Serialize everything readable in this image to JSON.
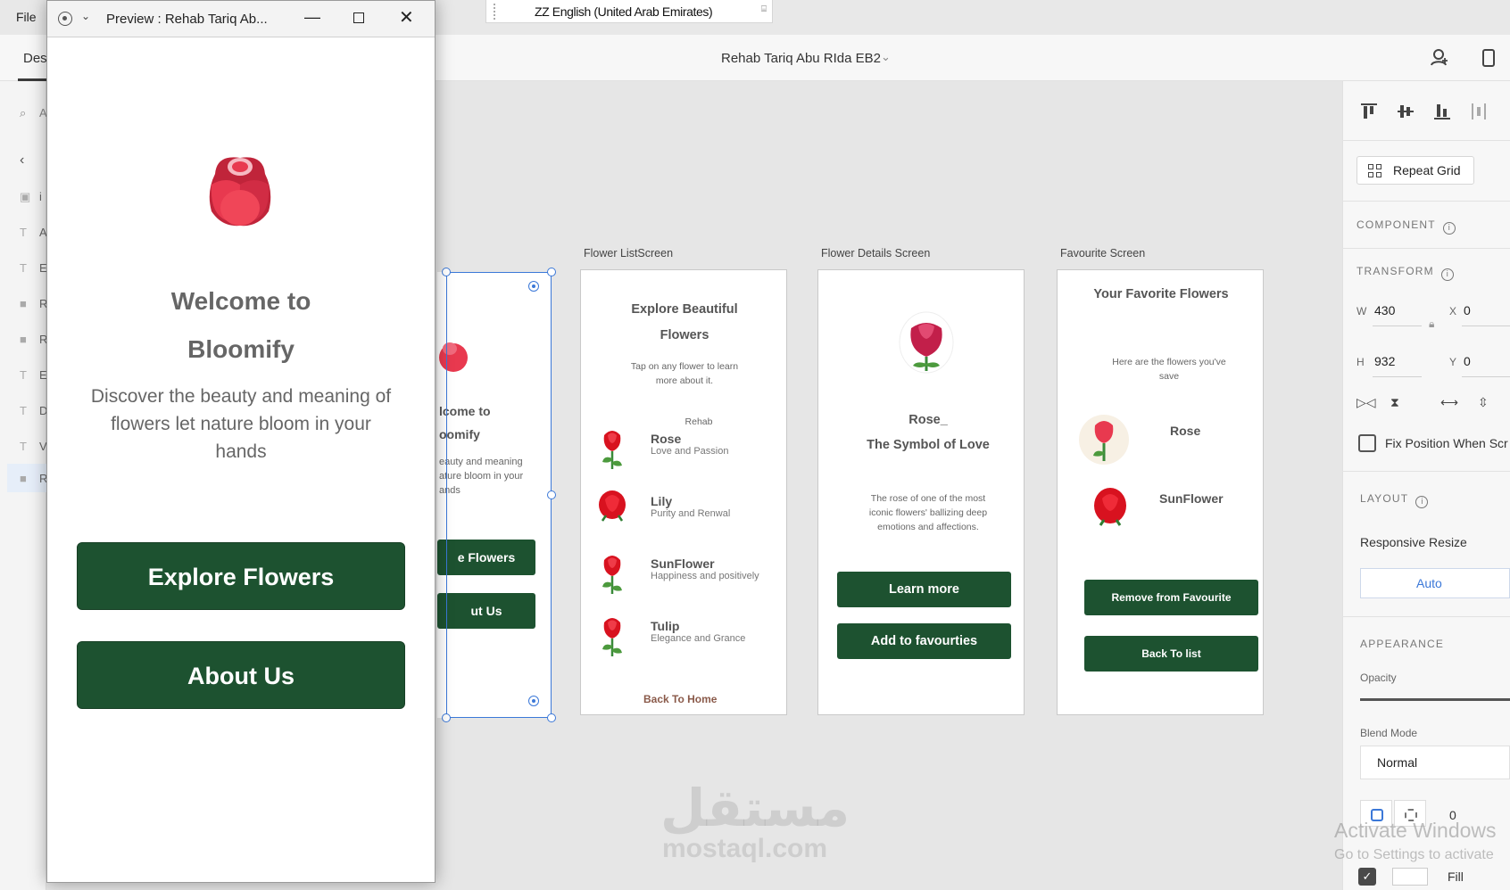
{
  "menu": {
    "file": "File"
  },
  "ime": {
    "label": "ZZ English (United Arab Emirates)"
  },
  "toolbar": {
    "tab_design": "Des",
    "document_title": "Rehab Tariq Abu RIda EB2"
  },
  "left_panel": {
    "search_glyph": "A",
    "items": [
      "i",
      "A",
      "E",
      "R",
      "R",
      "E",
      "D",
      "V",
      "R"
    ]
  },
  "preview": {
    "window_title": "Preview : Rehab Tariq Ab...",
    "heading_line1": "Welcome to",
    "heading_line2": "Bloomify",
    "description": "Discover the beauty and meaning of flowers let nature bloom in your hands",
    "explore_button": "Explore Flowers",
    "about_button": "About Us"
  },
  "artboards": {
    "partial": {
      "heading1": "lcome to",
      "heading2": "oomify",
      "desc": "eauty and meaning\nature bloom in your\nands",
      "btn1": "e Flowers",
      "btn2": "ut Us"
    },
    "list": {
      "label": "Flower ListScreen",
      "title": "Explore Beautiful Flowers",
      "subtitle": "Tap on any flower to learn more about it.",
      "author": "Rehab",
      "items": [
        {
          "name": "Rose",
          "desc": "Love and Passion"
        },
        {
          "name": "Lily",
          "desc": "Purity and Renwal"
        },
        {
          "name": "SunFlower",
          "desc": "Happiness and positively"
        },
        {
          "name": "Tulip",
          "desc": "Elegance and Grance"
        }
      ],
      "back_link": "Back To Home"
    },
    "details": {
      "label": "Flower Details Screen",
      "name": "Rose_",
      "tagline": "The Symbol of Love",
      "description": "The rose of one of the most iconic flowers' ballizing deep emotions and affections.",
      "learn_more": "Learn more",
      "add_fav": "Add to favourties"
    },
    "favourite": {
      "label": "Favourite Screen",
      "title": "Your Favorite Flowers",
      "subtitle": "Here are the flowers you've save",
      "items": [
        {
          "name": "Rose"
        },
        {
          "name": "SunFlower"
        }
      ],
      "remove_btn": "Remove from Favourite",
      "back_btn": "Back To list"
    }
  },
  "right_panel": {
    "repeat_grid": "Repeat Grid",
    "component_label": "COMPONENT",
    "transform_label": "TRANSFORM",
    "w_label": "W",
    "w_value": "430",
    "x_label": "X",
    "x_value": "0",
    "h_label": "H",
    "h_value": "932",
    "y_label": "Y",
    "y_value": "0",
    "fix_position": "Fix Position When Scr",
    "layout_label": "LAYOUT",
    "responsive_resize": "Responsive Resize",
    "auto": "Auto",
    "appearance_label": "APPEARANCE",
    "opacity_label": "Opacity",
    "blend_label": "Blend Mode",
    "blend_value": "Normal",
    "corner_value": "0",
    "fill_label": "Fill"
  },
  "os": {
    "activate_title": "Activate Windows",
    "activate_sub": "Go to Settings to activate"
  },
  "watermark": {
    "arabic": "مستقل",
    "latin": "mostaql.com"
  },
  "colors": {
    "button_green": "#1d5230",
    "selection_blue": "#3b78d8",
    "rose_red": "#e8394f"
  }
}
